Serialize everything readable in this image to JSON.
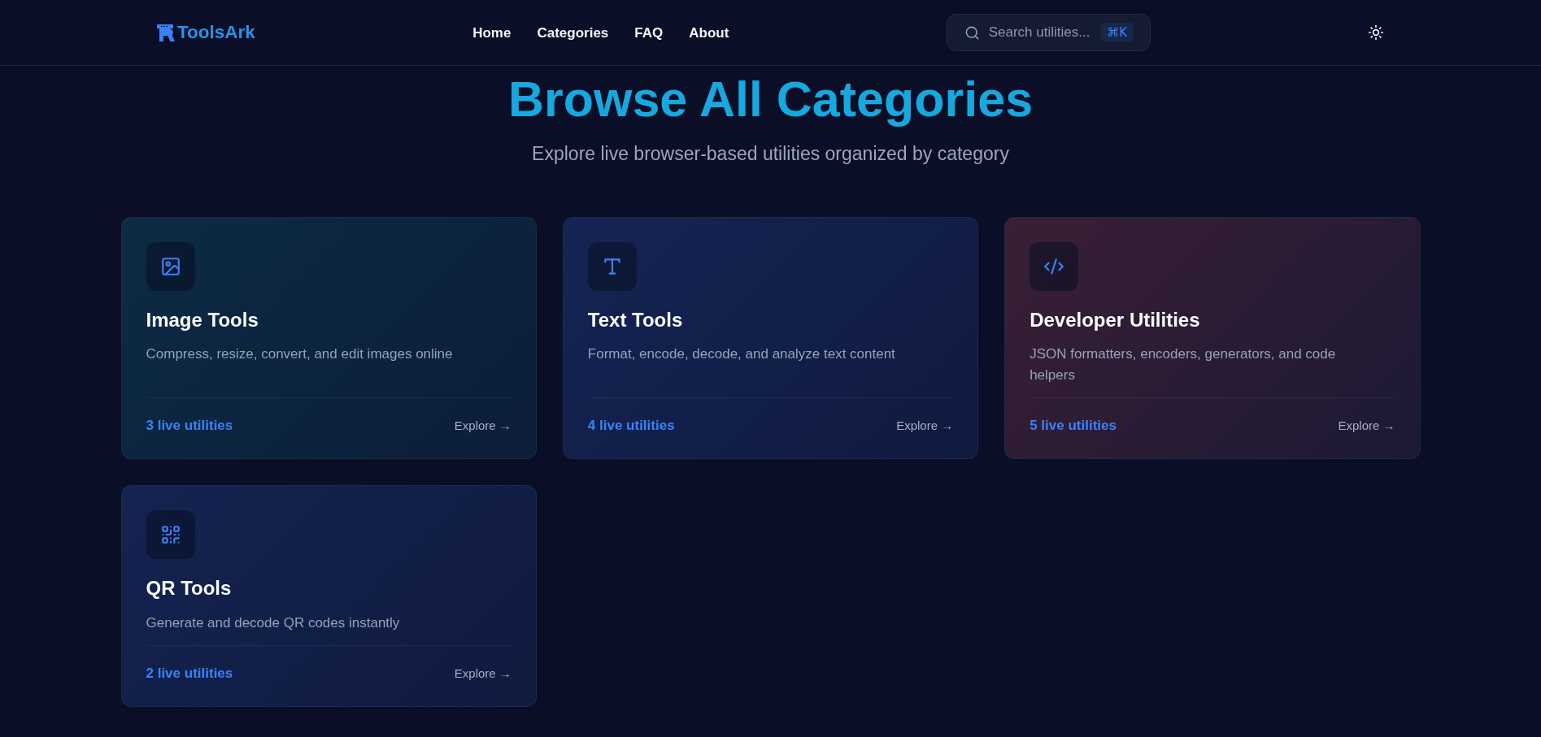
{
  "header": {
    "logo": "ToolsArk",
    "nav": [
      "Home",
      "Categories",
      "FAQ",
      "About"
    ],
    "search": {
      "placeholder": "Search utilities...",
      "shortcut": "⌘K"
    }
  },
  "hero": {
    "title": "Browse All Categories",
    "subtitle": "Explore live browser-based utilities organized by category"
  },
  "categories": [
    {
      "kind": "image",
      "color": "#0c2b45",
      "title": "Image Tools",
      "description": "Compress, resize, convert, and edit images online",
      "count": "3 live utilities",
      "link": "Explore →"
    },
    {
      "kind": "text",
      "color": "#152454",
      "title": "Text Tools",
      "description": "Format, encode, decode, and analyze text content",
      "count": "4 live utilities",
      "link": "Explore →"
    },
    {
      "kind": "code",
      "color": "#3a1f35",
      "title": "Developer Utilities",
      "description": "JSON formatters, encoders, generators, and code helpers",
      "count": "5 live utilities",
      "link": "Explore →"
    },
    {
      "kind": "qr",
      "color": "#142351",
      "title": "QR Tools",
      "description": "Generate and decode QR codes instantly",
      "count": "2 live utilities",
      "link": "Explore →"
    }
  ]
}
